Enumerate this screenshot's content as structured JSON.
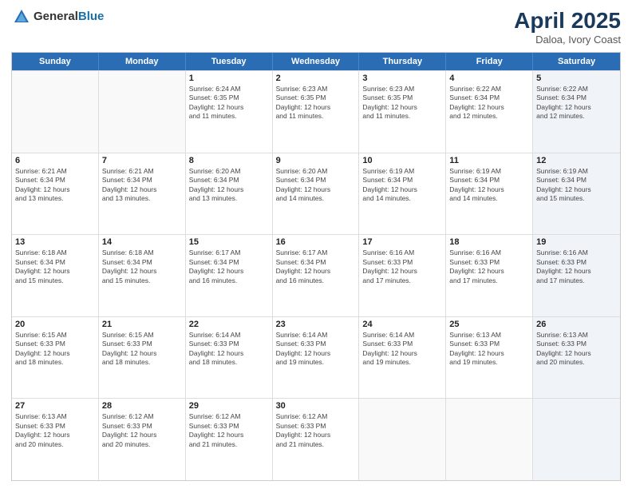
{
  "header": {
    "logo_general": "General",
    "logo_blue": "Blue",
    "title": "April 2025",
    "location": "Daloa, Ivory Coast"
  },
  "days_of_week": [
    "Sunday",
    "Monday",
    "Tuesday",
    "Wednesday",
    "Thursday",
    "Friday",
    "Saturday"
  ],
  "weeks": [
    [
      {
        "day": "",
        "info": [],
        "empty": true
      },
      {
        "day": "",
        "info": [],
        "empty": true
      },
      {
        "day": "1",
        "info": [
          "Sunrise: 6:24 AM",
          "Sunset: 6:35 PM",
          "Daylight: 12 hours",
          "and 11 minutes."
        ],
        "empty": false
      },
      {
        "day": "2",
        "info": [
          "Sunrise: 6:23 AM",
          "Sunset: 6:35 PM",
          "Daylight: 12 hours",
          "and 11 minutes."
        ],
        "empty": false
      },
      {
        "day": "3",
        "info": [
          "Sunrise: 6:23 AM",
          "Sunset: 6:35 PM",
          "Daylight: 12 hours",
          "and 11 minutes."
        ],
        "empty": false
      },
      {
        "day": "4",
        "info": [
          "Sunrise: 6:22 AM",
          "Sunset: 6:34 PM",
          "Daylight: 12 hours",
          "and 12 minutes."
        ],
        "empty": false
      },
      {
        "day": "5",
        "info": [
          "Sunrise: 6:22 AM",
          "Sunset: 6:34 PM",
          "Daylight: 12 hours",
          "and 12 minutes."
        ],
        "empty": false,
        "shaded": true
      }
    ],
    [
      {
        "day": "6",
        "info": [
          "Sunrise: 6:21 AM",
          "Sunset: 6:34 PM",
          "Daylight: 12 hours",
          "and 13 minutes."
        ],
        "empty": false
      },
      {
        "day": "7",
        "info": [
          "Sunrise: 6:21 AM",
          "Sunset: 6:34 PM",
          "Daylight: 12 hours",
          "and 13 minutes."
        ],
        "empty": false
      },
      {
        "day": "8",
        "info": [
          "Sunrise: 6:20 AM",
          "Sunset: 6:34 PM",
          "Daylight: 12 hours",
          "and 13 minutes."
        ],
        "empty": false
      },
      {
        "day": "9",
        "info": [
          "Sunrise: 6:20 AM",
          "Sunset: 6:34 PM",
          "Daylight: 12 hours",
          "and 14 minutes."
        ],
        "empty": false
      },
      {
        "day": "10",
        "info": [
          "Sunrise: 6:19 AM",
          "Sunset: 6:34 PM",
          "Daylight: 12 hours",
          "and 14 minutes."
        ],
        "empty": false
      },
      {
        "day": "11",
        "info": [
          "Sunrise: 6:19 AM",
          "Sunset: 6:34 PM",
          "Daylight: 12 hours",
          "and 14 minutes."
        ],
        "empty": false
      },
      {
        "day": "12",
        "info": [
          "Sunrise: 6:19 AM",
          "Sunset: 6:34 PM",
          "Daylight: 12 hours",
          "and 15 minutes."
        ],
        "empty": false,
        "shaded": true
      }
    ],
    [
      {
        "day": "13",
        "info": [
          "Sunrise: 6:18 AM",
          "Sunset: 6:34 PM",
          "Daylight: 12 hours",
          "and 15 minutes."
        ],
        "empty": false
      },
      {
        "day": "14",
        "info": [
          "Sunrise: 6:18 AM",
          "Sunset: 6:34 PM",
          "Daylight: 12 hours",
          "and 15 minutes."
        ],
        "empty": false
      },
      {
        "day": "15",
        "info": [
          "Sunrise: 6:17 AM",
          "Sunset: 6:34 PM",
          "Daylight: 12 hours",
          "and 16 minutes."
        ],
        "empty": false
      },
      {
        "day": "16",
        "info": [
          "Sunrise: 6:17 AM",
          "Sunset: 6:34 PM",
          "Daylight: 12 hours",
          "and 16 minutes."
        ],
        "empty": false
      },
      {
        "day": "17",
        "info": [
          "Sunrise: 6:16 AM",
          "Sunset: 6:33 PM",
          "Daylight: 12 hours",
          "and 17 minutes."
        ],
        "empty": false
      },
      {
        "day": "18",
        "info": [
          "Sunrise: 6:16 AM",
          "Sunset: 6:33 PM",
          "Daylight: 12 hours",
          "and 17 minutes."
        ],
        "empty": false
      },
      {
        "day": "19",
        "info": [
          "Sunrise: 6:16 AM",
          "Sunset: 6:33 PM",
          "Daylight: 12 hours",
          "and 17 minutes."
        ],
        "empty": false,
        "shaded": true
      }
    ],
    [
      {
        "day": "20",
        "info": [
          "Sunrise: 6:15 AM",
          "Sunset: 6:33 PM",
          "Daylight: 12 hours",
          "and 18 minutes."
        ],
        "empty": false
      },
      {
        "day": "21",
        "info": [
          "Sunrise: 6:15 AM",
          "Sunset: 6:33 PM",
          "Daylight: 12 hours",
          "and 18 minutes."
        ],
        "empty": false
      },
      {
        "day": "22",
        "info": [
          "Sunrise: 6:14 AM",
          "Sunset: 6:33 PM",
          "Daylight: 12 hours",
          "and 18 minutes."
        ],
        "empty": false
      },
      {
        "day": "23",
        "info": [
          "Sunrise: 6:14 AM",
          "Sunset: 6:33 PM",
          "Daylight: 12 hours",
          "and 19 minutes."
        ],
        "empty": false
      },
      {
        "day": "24",
        "info": [
          "Sunrise: 6:14 AM",
          "Sunset: 6:33 PM",
          "Daylight: 12 hours",
          "and 19 minutes."
        ],
        "empty": false
      },
      {
        "day": "25",
        "info": [
          "Sunrise: 6:13 AM",
          "Sunset: 6:33 PM",
          "Daylight: 12 hours",
          "and 19 minutes."
        ],
        "empty": false
      },
      {
        "day": "26",
        "info": [
          "Sunrise: 6:13 AM",
          "Sunset: 6:33 PM",
          "Daylight: 12 hours",
          "and 20 minutes."
        ],
        "empty": false,
        "shaded": true
      }
    ],
    [
      {
        "day": "27",
        "info": [
          "Sunrise: 6:13 AM",
          "Sunset: 6:33 PM",
          "Daylight: 12 hours",
          "and 20 minutes."
        ],
        "empty": false
      },
      {
        "day": "28",
        "info": [
          "Sunrise: 6:12 AM",
          "Sunset: 6:33 PM",
          "Daylight: 12 hours",
          "and 20 minutes."
        ],
        "empty": false
      },
      {
        "day": "29",
        "info": [
          "Sunrise: 6:12 AM",
          "Sunset: 6:33 PM",
          "Daylight: 12 hours",
          "and 21 minutes."
        ],
        "empty": false
      },
      {
        "day": "30",
        "info": [
          "Sunrise: 6:12 AM",
          "Sunset: 6:33 PM",
          "Daylight: 12 hours",
          "and 21 minutes."
        ],
        "empty": false
      },
      {
        "day": "",
        "info": [],
        "empty": true
      },
      {
        "day": "",
        "info": [],
        "empty": true
      },
      {
        "day": "",
        "info": [],
        "empty": true,
        "shaded": true
      }
    ]
  ]
}
